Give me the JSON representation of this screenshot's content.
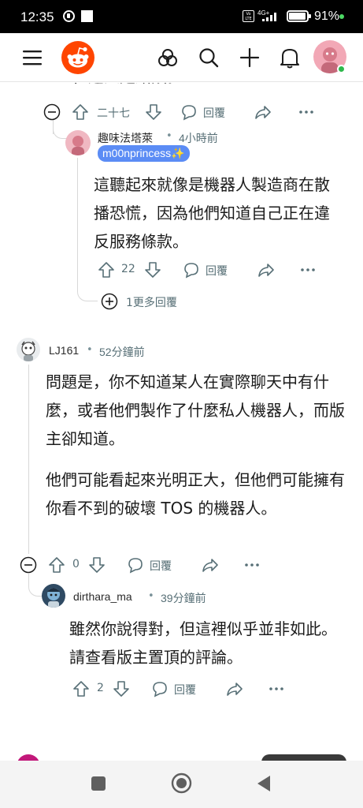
{
  "status_bar": {
    "time": "12:35",
    "network": "4G+",
    "volte": "Vo LTE",
    "battery": "91%"
  },
  "header": {
    "icons": [
      "menu-icon",
      "reddit-logo-icon",
      "communities-icon",
      "search-icon",
      "create-icon",
      "notifications-icon",
      "avatar"
    ]
  },
  "truncated_text": "但這人是錯誤。",
  "comment_actions_top": {
    "votes": "二十七",
    "reply": "回覆"
  },
  "comment_a": {
    "username": "趣味法塔萊",
    "dot": "•",
    "time": "4小時前",
    "flair": "m00nprincess✨",
    "body": "這聽起來就像是機器人製造商在散播恐慌，因為他們知道自己正在違反服務條款。",
    "votes": "22",
    "reply": "回覆",
    "more_replies": "1更多回覆"
  },
  "comment_b": {
    "username": "LJ161",
    "dot": "•",
    "time": "52分鐘前",
    "paragraph1": "問題是，你不知道某人在實際聊天中有什麼，或者他們製作了什麼私人機器人，而版主卻知道。",
    "paragraph2": "他們可能看起來光明正大，但他們可能擁有你看不到的破壞 TOS 的機器人。",
    "votes": "0",
    "reply": "回覆"
  },
  "comment_c": {
    "username": "dirthara_ma",
    "dot": "•",
    "time": "39分鐘前",
    "body": "雖然你說得對，但這裡似乎並非如此。請查看版主置頂的評論。",
    "votes": "2",
    "reply": "回覆"
  },
  "colors": {
    "reddit_orange": "#ff4500",
    "flair_blue": "#5b8cf5",
    "meta_gray": "#576f76",
    "online_green": "#2db84b"
  }
}
